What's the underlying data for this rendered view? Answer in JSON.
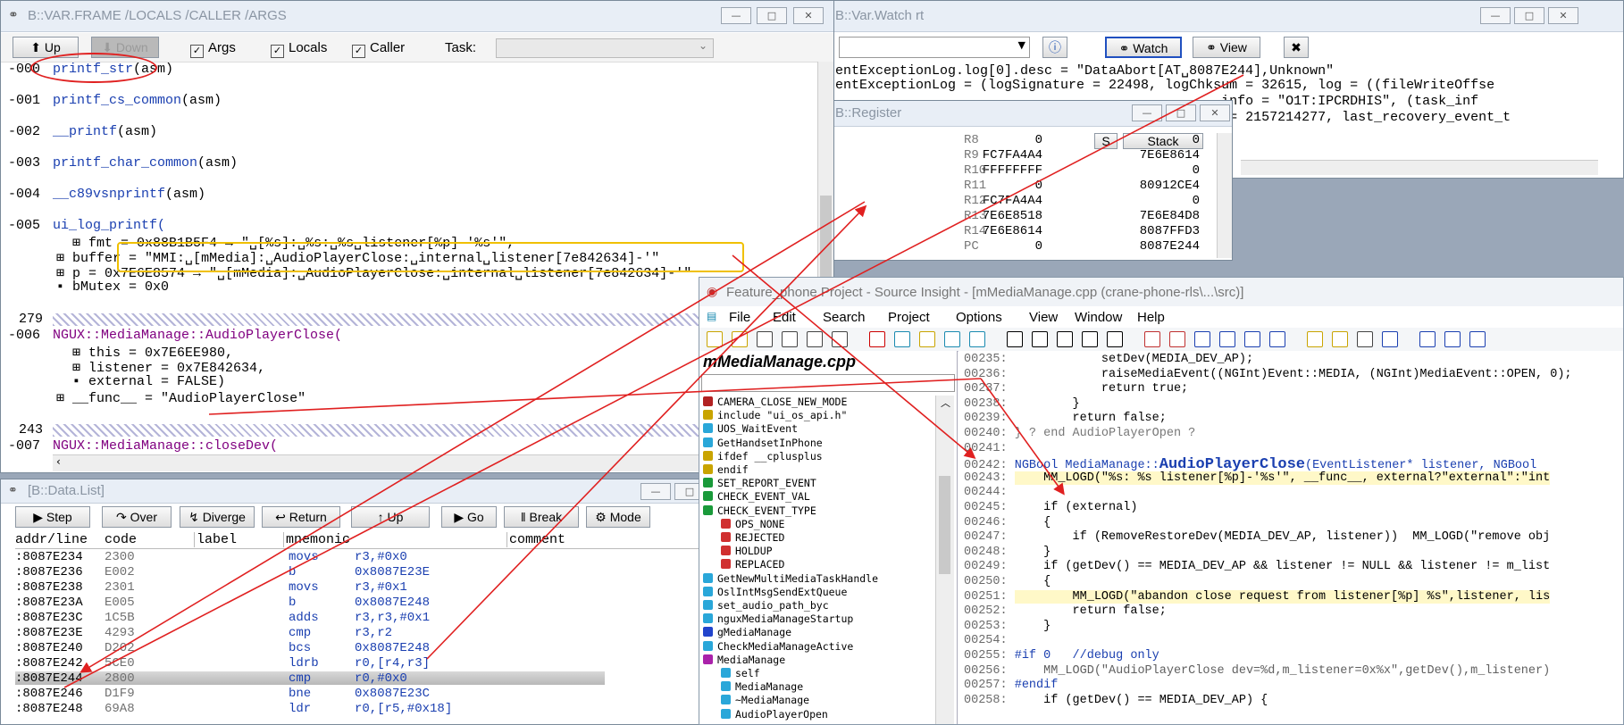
{
  "frame_window": {
    "title": "B::VAR.FRAME /LOCALS /CALLER /ARGS",
    "buttons": {
      "up": "Up",
      "down": "Down"
    },
    "checks": [
      {
        "label": "Args",
        "checked": true
      },
      {
        "label": "Locals",
        "checked": true
      },
      {
        "label": "Caller",
        "checked": true
      }
    ],
    "task_label": "Task:",
    "frames": [
      {
        "idx": "-000",
        "fn": "printf_str",
        "suffix": "(asm)"
      },
      {
        "idx": "-001",
        "fn": "printf_cs_common",
        "suffix": "(asm)"
      },
      {
        "idx": "-002",
        "fn": "__printf",
        "suffix": "(asm)"
      },
      {
        "idx": "-003",
        "fn": "printf_char_common",
        "suffix": "(asm)"
      },
      {
        "idx": "-004",
        "fn": "__c89vsnprintf",
        "suffix": "(asm)"
      },
      {
        "idx": "-005",
        "fn": "ui_log_printf("
      }
    ],
    "frame5_vars": [
      "⊞ fmt = 0x88B1B5F4 → \"␣[%s]:␣%s:␣%s␣listener[%p]-'%s'\",",
      "⊞ buffer = \"MMI:␣[mMedia]:␣AudioPlayerClose:␣internal␣listener[7e842634]-'\"",
      "⊞ p = 0x7E6E8574 → \"␣[mMedia]:␣AudioPlayerClose:␣internal␣listener[7e842634]-'\"",
      "▪ bMutex = 0x0"
    ],
    "line279": "279",
    "frame6_idx": "-006",
    "frame6_fn": "NGUX::MediaManage::AudioPlayerClose(",
    "frame6_vars": [
      "⊞ this = 0x7E6EE980,",
      "⊞ listener = 0x7E842634,",
      "▪ external = FALSE)"
    ],
    "frame6_func": "⊞ __func__ = \"AudioPlayerClose\"",
    "line243": "243",
    "frame7_idx": "-007",
    "frame7_fn": "NGUX::MediaManage::closeDev("
  },
  "var_window": {
    "title": "B::Var.Watch rt",
    "buttons": {
      "watch": "Watch",
      "view": "View"
    },
    "lines": [
      "entExceptionLog.log[0].desc = \"DataAbort[AT␣8087E244],Unknown\"",
      "entExceptionLog = (logSignature = 22498, logChksum = 32615, log = ((fileWriteOffse",
      "                                               _info = \"O1T:IPCRDHIS\", (task_inf",
      "                                               c = 2157214277, last_recovery_event_t"
    ]
  },
  "register_window": {
    "title": "B::Register",
    "stack_label": "Stack",
    "s_label": "S",
    "rows": [
      {
        "l": "0",
        "r": "R8",
        "v": "0"
      },
      {
        "l": "FC7FA4A4",
        "r": "R9",
        "v": "7E6E8614"
      },
      {
        "l": "FFFFFFFF",
        "r": "R10",
        "v": "0"
      },
      {
        "l": "0",
        "r": "R11",
        "v": "80912CE4"
      },
      {
        "l": "FC7FA4A4",
        "r": "R12",
        "v": "0"
      },
      {
        "l": "7E6E8518",
        "r": "R13",
        "v": "7E6E84D8"
      },
      {
        "l": "7E6E8614",
        "r": "R14",
        "v": "8087FFD3"
      },
      {
        "l": "0",
        "r": "PC",
        "v": "8087E244"
      }
    ]
  },
  "data_window": {
    "title": "[B::Data.List]",
    "buttons": [
      "Step",
      "Over",
      "Diverge",
      "Return",
      "Up",
      "Go",
      "Break",
      "Mode"
    ],
    "headers": [
      "addr/line",
      "code",
      "label",
      "mnemonic",
      "comment"
    ],
    "rows": [
      {
        "addr": ":8087E234",
        "code": "2300",
        "mn": "movs",
        "op": "r3,#0x0"
      },
      {
        "addr": ":8087E236",
        "code": "E002",
        "mn": "b",
        "op": "0x8087E23E"
      },
      {
        "addr": ":8087E238",
        "code": "2301",
        "mn": "movs",
        "op": "r3,#0x1"
      },
      {
        "addr": ":8087E23A",
        "code": "E005",
        "mn": "b",
        "op": "0x8087E248"
      },
      {
        "addr": ":8087E23C",
        "code": "1C5B",
        "mn": "adds",
        "op": "r3,r3,#0x1"
      },
      {
        "addr": ":8087E23E",
        "code": "4293",
        "mn": "cmp",
        "op": "r3,r2"
      },
      {
        "addr": ":8087E240",
        "code": "D202",
        "mn": "bcs",
        "op": "0x8087E248"
      },
      {
        "addr": ":8087E242",
        "code": "5CE0",
        "mn": "ldrb",
        "op": "r0,[r4,r3]"
      },
      {
        "addr": ":8087E244",
        "code": "2800",
        "mn": "cmp",
        "op": "r0,#0x0"
      },
      {
        "addr": ":8087E246",
        "code": "D1F9",
        "mn": "bne",
        "op": "0x8087E23C"
      },
      {
        "addr": ":8087E248",
        "code": "69A8",
        "mn": "ldr",
        "op": "r0,[r5,#0x18]"
      }
    ]
  },
  "si_window": {
    "title": "Feature_phone Project - Source Insight - [mMediaManage.cpp (crane-phone-rls\\...\\src)]",
    "menu": [
      "File",
      "Edit",
      "Search",
      "Project",
      "Options",
      "View",
      "Window",
      "Help"
    ],
    "file_name": "mMediaManage.cpp",
    "symbols": [
      {
        "t": "CAMERA_CLOSE_NEW_MODE",
        "c": "#b22222",
        "ind": 0
      },
      {
        "t": "include \"ui_os_api.h\"",
        "c": "#c9a400",
        "ind": 0
      },
      {
        "t": "UOS_WaitEvent",
        "c": "#2aa7d9",
        "ind": 0
      },
      {
        "t": "GetHandsetInPhone",
        "c": "#2aa7d9",
        "ind": 0
      },
      {
        "t": "ifdef __cplusplus",
        "c": "#c9a400",
        "ind": 0
      },
      {
        "t": "endif",
        "c": "#c9a400",
        "ind": 0
      },
      {
        "t": "SET_REPORT_EVENT",
        "c": "#1a9a3a",
        "ind": 0
      },
      {
        "t": "CHECK_EVENT_VAL",
        "c": "#1a9a3a",
        "ind": 0
      },
      {
        "t": "CHECK_EVENT_TYPE",
        "c": "#1a9a3a",
        "ind": 0
      },
      {
        "t": "OPS_NONE",
        "c": "#d03030",
        "ind": 1
      },
      {
        "t": "REJECTED",
        "c": "#d03030",
        "ind": 1
      },
      {
        "t": "HOLDUP",
        "c": "#d03030",
        "ind": 1
      },
      {
        "t": "REPLACED",
        "c": "#d03030",
        "ind": 1
      },
      {
        "t": "GetNewMultiMediaTaskHandle",
        "c": "#2aa7d9",
        "ind": 0
      },
      {
        "t": "OslIntMsgSendExtQueue",
        "c": "#2aa7d9",
        "ind": 0
      },
      {
        "t": "set_audio_path_byc",
        "c": "#2aa7d9",
        "ind": 0
      },
      {
        "t": "nguxMediaManageStartup",
        "c": "#2aa7d9",
        "ind": 0
      },
      {
        "t": "gMediaManage",
        "c": "#2244cc",
        "ind": 0
      },
      {
        "t": "CheckMediaManageActive",
        "c": "#2aa7d9",
        "ind": 0
      },
      {
        "t": "MediaManage",
        "c": "#aa22aa",
        "ind": 0
      },
      {
        "t": "self",
        "c": "#2aa7d9",
        "ind": 1
      },
      {
        "t": "MediaManage",
        "c": "#2aa7d9",
        "ind": 1
      },
      {
        "t": "~MediaManage",
        "c": "#2aa7d9",
        "ind": 1
      },
      {
        "t": "AudioPlayerOpen",
        "c": "#2aa7d9",
        "ind": 1
      }
    ],
    "source": [
      {
        "n": "00235:",
        "code": "            setDev(MEDIA_DEV_AP);"
      },
      {
        "n": "00236:",
        "code": "            raiseMediaEvent((NGInt)Event::MEDIA, (NGInt)MediaEvent::OPEN, 0);"
      },
      {
        "n": "00237:",
        "code": "            return true;"
      },
      {
        "n": "00238:",
        "code": "        }"
      },
      {
        "n": "00239:",
        "code": "        return false;"
      },
      {
        "n": "00240:",
        "code": "} ? end AudioPlayerOpen ?"
      },
      {
        "n": "00241:",
        "code": ""
      },
      {
        "n": "00242:",
        "code": "NGBool MediaManage::"
      },
      {
        "n": "00243:",
        "code": "    MM_LOGD(\"%s: %s listener[%p]-'%s'\", __func__, external?\"external\":\"int"
      },
      {
        "n": "00244:",
        "code": ""
      },
      {
        "n": "00245:",
        "code": "    if (external)"
      },
      {
        "n": "00246:",
        "code": "    {"
      },
      {
        "n": "00247:",
        "code": "        if (RemoveRestoreDev(MEDIA_DEV_AP, listener))  MM_LOGD(\"remove obj"
      },
      {
        "n": "00248:",
        "code": "    }"
      },
      {
        "n": "00249:",
        "code": "    if (getDev() == MEDIA_DEV_AP && listener != NULL && listener != m_list"
      },
      {
        "n": "00250:",
        "code": "    {"
      },
      {
        "n": "00251:",
        "code": "        MM_LOGD(\"abandon close request from listener[%p] %s\",listener, lis"
      },
      {
        "n": "00252:",
        "code": "        return false;"
      },
      {
        "n": "00253:",
        "code": "    }"
      },
      {
        "n": "00254:",
        "code": ""
      },
      {
        "n": "00255:",
        "code": "#if 0   //debug only"
      },
      {
        "n": "00256:",
        "code": "    MM_LOGD(\"AudioPlayerClose dev=%d,m_listener=0x%x\",getDev(),m_listener)"
      },
      {
        "n": "00257:",
        "code": "#endif"
      },
      {
        "n": "00258:",
        "code": "    if (getDev() == MEDIA_DEV_AP) {"
      }
    ],
    "fn_name": "AudioPlayerClose",
    "fn_args": "(EventListener* listener, NGBool"
  },
  "colors": {
    "accent_red": "#e02020",
    "highlight_yellow": "#f0c000"
  }
}
